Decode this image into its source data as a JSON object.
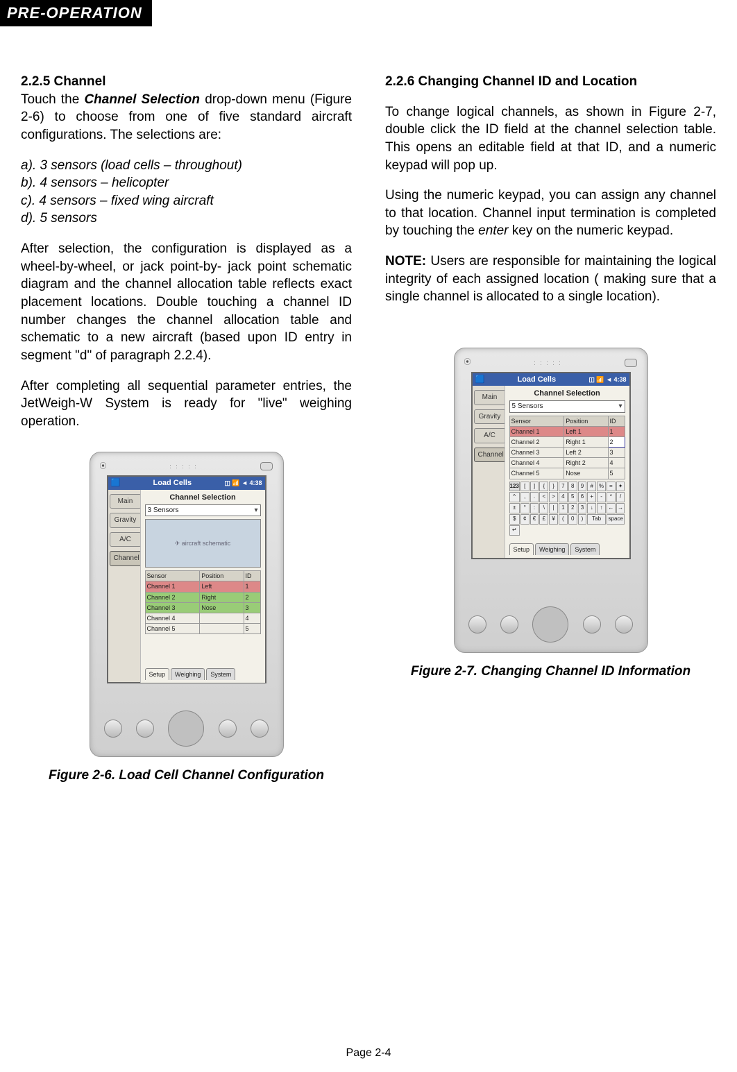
{
  "header": {
    "tag": "PRE-OPERATION"
  },
  "left": {
    "heading": "2.2.5 Channel",
    "intro_a": "Touch the ",
    "intro_b": "Channel Selection",
    "intro_c": " drop-down menu (Figure 2-6) to choose from one of five standard aircraft configurations. The selections are:",
    "options": {
      "a": "a). 3 sensors (load cells – throughout)",
      "b": "b). 4 sensors – helicopter",
      "c": "c). 4 sensors – fixed wing aircraft",
      "d": "d). 5 sensors"
    },
    "para2": "After selection, the configuration is displayed as a wheel-by-wheel, or jack point-by- jack point schematic diagram and the channel allocation table reflects exact placement locations. Double touching a channel ID number changes the channel allocation table and schematic to a new aircraft (based upon ID entry in segment \"d\" of paragraph 2.2.4).",
    "para3": "After completing all sequential parameter entries, the JetWeigh-W System is ready for \"live\" weighing operation.",
    "figcap": "Figure 2-6. Load Cell Channel Configuration"
  },
  "right": {
    "heading": "2.2.6 Changing Channel ID and Location",
    "para1": "To change logical channels, as shown in Figure 2-7, double click the ID field at the channel selection table. This opens an editable field at that ID, and a numeric keypad will pop up.",
    "para2_a": "Using the numeric keypad, you can assign any channel to that location. Channel input termination is completed by touching the ",
    "para2_b": "enter",
    "para2_c": " key on the numeric keypad.",
    "note_label": "NOTE:",
    "note": " Users are responsible for maintaining the logical integrity of each assigned location ( making sure that a single channel is allocated to a single location).",
    "figcap": "Figure 2-7. Changing Channel ID Information"
  },
  "pda_common": {
    "titlebar_app": "Load Cells",
    "titlebar_status": "◫ 📶 ◄ 4:38",
    "section_label": "Channel Selection",
    "side_tabs": {
      "main": "Main",
      "gravity": "Gravity",
      "ac": "A/C",
      "channel": "Channel"
    },
    "bottom_tabs": {
      "setup": "Setup",
      "weighing": "Weighing",
      "system": "System"
    },
    "table_headers": {
      "sensor": "Sensor",
      "position": "Position",
      "id": "ID"
    },
    "aircraft_placeholder": "✈ aircraft schematic"
  },
  "fig26": {
    "dropdown_value": "3 Sensors",
    "rows": [
      {
        "sensor": "Channel 1",
        "pos": "Left",
        "id": "1",
        "cls": "row-red"
      },
      {
        "sensor": "Channel 2",
        "pos": "Right",
        "id": "2",
        "cls": "row-grn"
      },
      {
        "sensor": "Channel 3",
        "pos": "Nose",
        "id": "3",
        "cls": "row-grn"
      },
      {
        "sensor": "Channel 4",
        "pos": "",
        "id": "4",
        "cls": ""
      },
      {
        "sensor": "Channel 5",
        "pos": "",
        "id": "5",
        "cls": ""
      }
    ]
  },
  "fig27": {
    "dropdown_value": "5 Sensors",
    "rows": [
      {
        "sensor": "Channel 1",
        "pos": "Left 1",
        "id": "1",
        "cls": "row-red"
      },
      {
        "sensor": "Channel 2",
        "pos": "Right 1",
        "id": "2",
        "cls": ""
      },
      {
        "sensor": "Channel 3",
        "pos": "Left 2",
        "id": "3",
        "cls": ""
      },
      {
        "sensor": "Channel 4",
        "pos": "Right 2",
        "id": "4",
        "cls": ""
      },
      {
        "sensor": "Channel 5",
        "pos": "Nose",
        "id": "5",
        "cls": ""
      }
    ],
    "keys": [
      "123",
      "[",
      "]",
      "{",
      "}",
      "7",
      "8",
      "9",
      "#",
      "%",
      "=",
      "✦",
      "^",
      ",",
      ".",
      "<",
      ">",
      "4",
      "5",
      "6",
      "+",
      "-",
      "*",
      "/",
      "±",
      "°",
      ":",
      "\\",
      "|",
      "1",
      "2",
      "3",
      "↓",
      "↑",
      "←",
      "→",
      "$",
      "¢",
      "€",
      "£",
      "¥",
      "(",
      "0",
      ")",
      "Tab",
      "space",
      "↵"
    ]
  },
  "footer": {
    "page": "Page 2-4"
  }
}
